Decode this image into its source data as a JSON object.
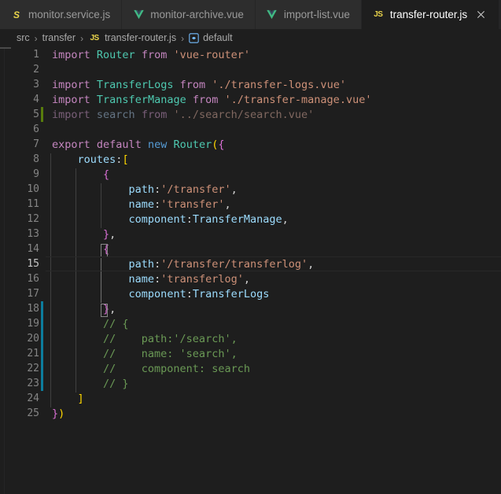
{
  "window": {
    "title": "transfer-router.js",
    "colors": {
      "editor_bg": "#1e1e1e",
      "tabbar_bg": "#252526",
      "inactive_tab_bg": "#2d2d2d",
      "diff_added": "#587c0c",
      "diff_modified": "#0c7d9d",
      "accent_string": "#ce9178",
      "accent_keyword": "#c586c0",
      "accent_comment": "#6a9955"
    }
  },
  "tabs": [
    {
      "label": "monitor.service.js",
      "icon": "service-file-icon",
      "icon_text": "S",
      "active": false,
      "dirty": false
    },
    {
      "label": "monitor-archive.vue",
      "icon": "vue-file-icon",
      "icon_text": "V",
      "active": false,
      "dirty": false
    },
    {
      "label": "import-list.vue",
      "icon": "vue-file-icon",
      "icon_text": "V",
      "active": false,
      "dirty": false
    },
    {
      "label": "transfer-router.js",
      "icon": "js-file-icon",
      "icon_text": "JS",
      "active": true,
      "dirty": false,
      "close_icon": "close-icon"
    }
  ],
  "breadcrumb": {
    "separator": "›",
    "items": [
      {
        "label": "src",
        "icon": null
      },
      {
        "label": "transfer",
        "icon": null
      },
      {
        "label": "transfer-router.js",
        "icon": "js-file-icon",
        "icon_text": "JS"
      },
      {
        "label": "default",
        "icon": "symbol-variable-icon"
      }
    ]
  },
  "editor": {
    "language": "javascript",
    "current_line": 15,
    "total_lines": 25,
    "lines": [
      {
        "n": 1,
        "diff": null,
        "dim": false,
        "current": false,
        "guides": [],
        "tokens": [
          {
            "t": "import",
            "c": "k"
          },
          {
            "t": " ",
            "c": "pl"
          },
          {
            "t": "Router",
            "c": "cls"
          },
          {
            "t": " ",
            "c": "pl"
          },
          {
            "t": "from",
            "c": "k"
          },
          {
            "t": " ",
            "c": "pl"
          },
          {
            "t": "'vue-router'",
            "c": "str"
          }
        ]
      },
      {
        "n": 2,
        "diff": null,
        "dim": false,
        "current": false,
        "guides": [],
        "tokens": []
      },
      {
        "n": 3,
        "diff": null,
        "dim": false,
        "current": false,
        "guides": [],
        "tokens": [
          {
            "t": "import",
            "c": "k"
          },
          {
            "t": " ",
            "c": "pl"
          },
          {
            "t": "TransferLogs",
            "c": "cls"
          },
          {
            "t": " ",
            "c": "pl"
          },
          {
            "t": "from",
            "c": "k"
          },
          {
            "t": " ",
            "c": "pl"
          },
          {
            "t": "'./transfer-logs.vue'",
            "c": "str"
          }
        ]
      },
      {
        "n": 4,
        "diff": null,
        "dim": false,
        "current": false,
        "guides": [],
        "tokens": [
          {
            "t": "import",
            "c": "k"
          },
          {
            "t": " ",
            "c": "pl"
          },
          {
            "t": "TransferManage",
            "c": "cls"
          },
          {
            "t": " ",
            "c": "pl"
          },
          {
            "t": "from",
            "c": "k"
          },
          {
            "t": " ",
            "c": "pl"
          },
          {
            "t": "'./transfer-manage.vue'",
            "c": "str"
          }
        ]
      },
      {
        "n": 5,
        "diff": "add",
        "dim": true,
        "current": false,
        "guides": [],
        "tokens": [
          {
            "t": "import",
            "c": "k"
          },
          {
            "t": " ",
            "c": "pl"
          },
          {
            "t": "search",
            "c": "id"
          },
          {
            "t": " ",
            "c": "pl"
          },
          {
            "t": "from",
            "c": "k"
          },
          {
            "t": " ",
            "c": "pl"
          },
          {
            "t": "'../search/search.vue'",
            "c": "str"
          }
        ]
      },
      {
        "n": 6,
        "diff": null,
        "dim": false,
        "current": false,
        "guides": [],
        "tokens": []
      },
      {
        "n": 7,
        "diff": null,
        "dim": false,
        "current": false,
        "guides": [],
        "tokens": [
          {
            "t": "export",
            "c": "k"
          },
          {
            "t": " ",
            "c": "pl"
          },
          {
            "t": "default",
            "c": "k"
          },
          {
            "t": " ",
            "c": "pl"
          },
          {
            "t": "new",
            "c": "kb"
          },
          {
            "t": " ",
            "c": "pl"
          },
          {
            "t": "Router",
            "c": "cls"
          },
          {
            "t": "(",
            "c": "by"
          },
          {
            "t": "{",
            "c": "bp"
          }
        ]
      },
      {
        "n": 8,
        "diff": null,
        "dim": false,
        "current": false,
        "guides": [
          "g1"
        ],
        "tokens": [
          {
            "t": "    ",
            "c": "pl"
          },
          {
            "t": "routes",
            "c": "id"
          },
          {
            "t": ":",
            "c": "pl"
          },
          {
            "t": "[",
            "c": "by"
          }
        ]
      },
      {
        "n": 9,
        "diff": null,
        "dim": false,
        "current": false,
        "guides": [
          "g1",
          "g2"
        ],
        "tokens": [
          {
            "t": "        ",
            "c": "pl"
          },
          {
            "t": "{",
            "c": "bp"
          }
        ]
      },
      {
        "n": 10,
        "diff": null,
        "dim": false,
        "current": false,
        "guides": [
          "g1",
          "g2",
          "g3"
        ],
        "tokens": [
          {
            "t": "            ",
            "c": "pl"
          },
          {
            "t": "path",
            "c": "id"
          },
          {
            "t": ":",
            "c": "pl"
          },
          {
            "t": "'/transfer'",
            "c": "str"
          },
          {
            "t": ",",
            "c": "pl"
          }
        ]
      },
      {
        "n": 11,
        "diff": null,
        "dim": false,
        "current": false,
        "guides": [
          "g1",
          "g2",
          "g3"
        ],
        "tokens": [
          {
            "t": "            ",
            "c": "pl"
          },
          {
            "t": "name",
            "c": "id"
          },
          {
            "t": ":",
            "c": "pl"
          },
          {
            "t": "'transfer'",
            "c": "str"
          },
          {
            "t": ",",
            "c": "pl"
          }
        ]
      },
      {
        "n": 12,
        "diff": null,
        "dim": false,
        "current": false,
        "guides": [
          "g1",
          "g2",
          "g3"
        ],
        "tokens": [
          {
            "t": "            ",
            "c": "pl"
          },
          {
            "t": "component",
            "c": "id"
          },
          {
            "t": ":",
            "c": "pl"
          },
          {
            "t": "TransferManage",
            "c": "id"
          },
          {
            "t": ",",
            "c": "pl"
          }
        ]
      },
      {
        "n": 13,
        "diff": null,
        "dim": false,
        "current": false,
        "guides": [
          "g1",
          "g2"
        ],
        "tokens": [
          {
            "t": "        ",
            "c": "pl"
          },
          {
            "t": "}",
            "c": "bp"
          },
          {
            "t": ",",
            "c": "pl"
          }
        ]
      },
      {
        "n": 14,
        "diff": null,
        "dim": false,
        "current": false,
        "guides": [
          "g1",
          "g2"
        ],
        "bracket_match": "open",
        "tokens": [
          {
            "t": "        ",
            "c": "pl"
          },
          {
            "t": "{",
            "c": "bp"
          }
        ]
      },
      {
        "n": 15,
        "diff": null,
        "dim": false,
        "current": true,
        "guides": [
          "g1",
          "g2",
          "g3a"
        ],
        "tokens": [
          {
            "t": "            ",
            "c": "pl"
          },
          {
            "t": "path",
            "c": "id"
          },
          {
            "t": ":",
            "c": "pl"
          },
          {
            "t": "'/transfer/transferlog'",
            "c": "str"
          },
          {
            "t": ",",
            "c": "pl"
          }
        ]
      },
      {
        "n": 16,
        "diff": null,
        "dim": false,
        "current": false,
        "guides": [
          "g1",
          "g2",
          "g3a"
        ],
        "tokens": [
          {
            "t": "            ",
            "c": "pl"
          },
          {
            "t": "name",
            "c": "id"
          },
          {
            "t": ":",
            "c": "pl"
          },
          {
            "t": "'transferlog'",
            "c": "str"
          },
          {
            "t": ",",
            "c": "pl"
          }
        ]
      },
      {
        "n": 17,
        "diff": null,
        "dim": false,
        "current": false,
        "guides": [
          "g1",
          "g2",
          "g3a"
        ],
        "tokens": [
          {
            "t": "            ",
            "c": "pl"
          },
          {
            "t": "component",
            "c": "id"
          },
          {
            "t": ":",
            "c": "pl"
          },
          {
            "t": "TransferLogs",
            "c": "id"
          }
        ]
      },
      {
        "n": 18,
        "diff": "mod",
        "dim": false,
        "current": false,
        "guides": [
          "g1",
          "g2"
        ],
        "bracket_match": "close",
        "tokens": [
          {
            "t": "        ",
            "c": "pl"
          },
          {
            "t": "}",
            "c": "bp"
          },
          {
            "t": ",",
            "c": "pl"
          }
        ]
      },
      {
        "n": 19,
        "diff": "mod",
        "dim": false,
        "current": false,
        "guides": [
          "g1",
          "g2"
        ],
        "tokens": [
          {
            "t": "        // {",
            "c": "cm"
          }
        ]
      },
      {
        "n": 20,
        "diff": "mod",
        "dim": false,
        "current": false,
        "guides": [
          "g1",
          "g2"
        ],
        "tokens": [
          {
            "t": "        //    path:'/search',",
            "c": "cm"
          }
        ]
      },
      {
        "n": 21,
        "diff": "mod",
        "dim": false,
        "current": false,
        "guides": [
          "g1",
          "g2"
        ],
        "tokens": [
          {
            "t": "        //    name: 'search',",
            "c": "cm"
          }
        ]
      },
      {
        "n": 22,
        "diff": "mod",
        "dim": false,
        "current": false,
        "guides": [
          "g1",
          "g2"
        ],
        "tokens": [
          {
            "t": "        //    component: search",
            "c": "cm"
          }
        ]
      },
      {
        "n": 23,
        "diff": "mod",
        "dim": false,
        "current": false,
        "guides": [
          "g1",
          "g2"
        ],
        "tokens": [
          {
            "t": "        // }",
            "c": "cm"
          }
        ]
      },
      {
        "n": 24,
        "diff": null,
        "dim": false,
        "current": false,
        "guides": [
          "g1"
        ],
        "tokens": [
          {
            "t": "    ",
            "c": "pl"
          },
          {
            "t": "]",
            "c": "by"
          }
        ]
      },
      {
        "n": 25,
        "diff": null,
        "dim": false,
        "current": false,
        "guides": [],
        "tokens": [
          {
            "t": "}",
            "c": "bp"
          },
          {
            "t": ")",
            "c": "by"
          }
        ]
      }
    ]
  }
}
